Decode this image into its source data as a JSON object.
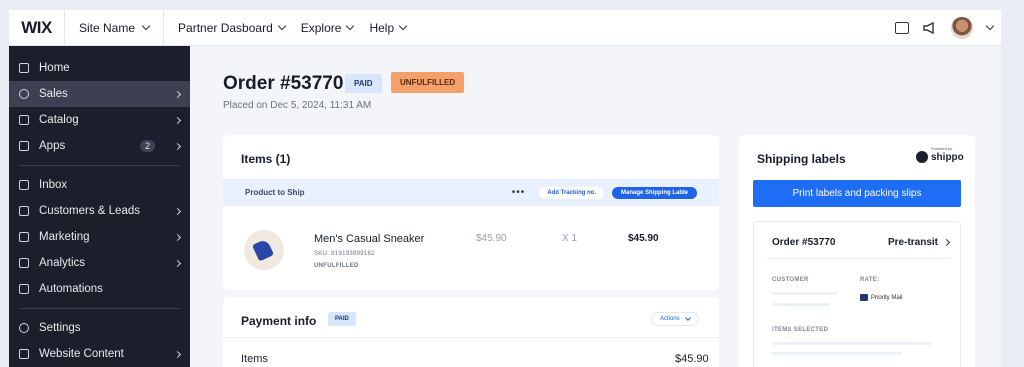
{
  "topbar": {
    "logo": "WIX",
    "site_name": "Site Name",
    "nav": [
      "Partner Dasboard",
      "Explore",
      "Help"
    ]
  },
  "sidebar": {
    "items": [
      {
        "label": "Home",
        "icon": "home-icon"
      },
      {
        "label": "Sales",
        "icon": "dollar-icon",
        "active": true
      },
      {
        "label": "Catalog",
        "icon": "tag-icon"
      },
      {
        "label": "Apps",
        "icon": "grid-icon",
        "badge": "2"
      },
      {
        "label": "Inbox",
        "icon": "inbox-icon"
      },
      {
        "label": "Customers & Leads",
        "icon": "users-icon"
      },
      {
        "label": "Marketing",
        "icon": "megaphone-icon"
      },
      {
        "label": "Analytics",
        "icon": "chart-icon"
      },
      {
        "label": "Automations",
        "icon": "bolt-icon"
      },
      {
        "label": "Settings",
        "icon": "gear-icon"
      },
      {
        "label": "Website Content",
        "icon": "file-icon"
      }
    ]
  },
  "order": {
    "title": "Order #53770",
    "status_paid": "PAID",
    "status_fulfillment": "UNFULFILLED",
    "placed": "Placed on Dec 5, 2024, 11:31 AM"
  },
  "items_card": {
    "heading": "Items (1)",
    "ship_label": "Product to Ship",
    "more": "•••",
    "add_tracking": "Add Tracking no.",
    "manage_label": "Manage Shipping Lable",
    "product": {
      "name": "Men's Casual Sneaker",
      "sku": "SKU: 819193899162",
      "status": "UNFULFILLED",
      "price": "$45.90",
      "qty": "X 1",
      "total": "$45.90"
    }
  },
  "payment": {
    "heading": "Payment info",
    "badge": "PAID",
    "actions": "Actions",
    "items_label": "Items",
    "items_value": "$45.90"
  },
  "shipping": {
    "heading": "Shipping labels",
    "powered": "Powered by",
    "brand": "shippo",
    "print_button": "Print labels and packing slips",
    "order": "Order #53770",
    "status": "Pre-transit",
    "customer_label": "CUSTOMER",
    "rate_label": "RATE:",
    "rate_value": "Priority Mail",
    "items_label": "ITEMS SELECTED"
  },
  "colors": {
    "primary": "#1f6cf5",
    "sidebar_bg": "#1b1f2b",
    "unfulfilled": "#f4a06a",
    "paid": "#d7e6fb"
  }
}
